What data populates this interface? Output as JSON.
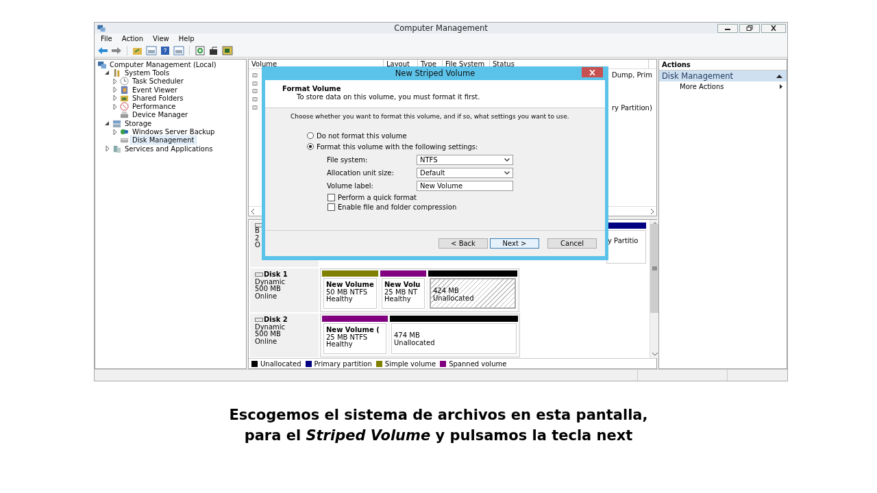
{
  "window": {
    "title": "Computer Management"
  },
  "menu": [
    "File",
    "Action",
    "View",
    "Help"
  ],
  "tree": [
    {
      "label": "Computer Management (Local)",
      "selected": false,
      "children": [
        {
          "label": "System Tools",
          "expanded": true,
          "selected": false,
          "children": [
            {
              "label": "Task Scheduler",
              "expanded": false,
              "selected": false
            },
            {
              "label": "Event Viewer",
              "expanded": false,
              "selected": false
            },
            {
              "label": "Shared Folders",
              "expanded": false,
              "selected": false
            },
            {
              "label": "Performance",
              "expanded": false,
              "selected": false
            },
            {
              "label": "Device Manager",
              "selected": false
            }
          ]
        },
        {
          "label": "Storage",
          "expanded": true,
          "selected": false,
          "children": [
            {
              "label": "Windows Server Backup",
              "expanded": false,
              "selected": false
            },
            {
              "label": "Disk Management",
              "selected": true
            }
          ]
        },
        {
          "label": "Services and Applications",
          "expanded": false,
          "selected": false
        }
      ]
    }
  ],
  "volume_list": {
    "columns": [
      "Volume",
      "Layout",
      "Type",
      "File System",
      "Status"
    ],
    "rows": [
      {
        "status_fragment": "Dump, Prim"
      },
      {},
      {},
      {},
      {
        "status_fragment": "ry Partition)"
      }
    ]
  },
  "disks": [
    {
      "lines": [
        "B",
        "2",
        "O"
      ],
      "partitions": [
        {
          "color": "#000080",
          "lines": [
            "y Partitio"
          ],
          "selected": false
        }
      ]
    },
    {
      "name": "Disk 1",
      "lines": [
        "Dynamic",
        "500 MB",
        "Online"
      ],
      "partitions": [
        {
          "color": "#808000",
          "title": "New Volume",
          "lines": [
            "50 MB NTFS",
            "Healthy"
          ],
          "selected": false
        },
        {
          "color": "#800080",
          "title": "New Volu",
          "lines": [
            "25 MB NT",
            "Healthy"
          ],
          "selected": false
        },
        {
          "color": "#000000",
          "lines": [
            "424 MB",
            "Unallocated"
          ],
          "selected": true
        }
      ]
    },
    {
      "name": "Disk 2",
      "lines": [
        "Dynamic",
        "500 MB",
        "Online"
      ],
      "partitions": [
        {
          "color": "#800080",
          "title": "New Volume  (",
          "lines": [
            "25 MB NTFS",
            "Healthy"
          ],
          "selected": false
        },
        {
          "color": "#000000",
          "lines": [
            "474 MB",
            "Unallocated"
          ],
          "selected": false
        }
      ]
    }
  ],
  "legend": [
    {
      "label": "Unallocated",
      "color": "#000000"
    },
    {
      "label": "Primary partition",
      "color": "#000080"
    },
    {
      "label": "Simple volume",
      "color": "#808000"
    },
    {
      "label": "Spanned volume",
      "color": "#800080"
    }
  ],
  "actions": {
    "title": "Actions",
    "section": "Disk Management",
    "items": [
      "More Actions"
    ]
  },
  "dialog": {
    "title": "New Striped Volume",
    "heading": "Format Volume",
    "subheading": "To store data on this volume, you must format it first.",
    "prompt": "Choose whether you want to format this volume, and if so, what settings you want to use.",
    "options": [
      {
        "label": "Do not format this volume",
        "selected": false
      },
      {
        "label": "Format this volume with the following settings:",
        "selected": true
      }
    ],
    "fields": [
      {
        "kind": "select",
        "label": "File system:",
        "value": "NTFS"
      },
      {
        "kind": "select",
        "label": "Allocation unit size:",
        "value": "Default"
      },
      {
        "kind": "text",
        "label": "Volume label:",
        "value": "New Volume"
      }
    ],
    "checkboxes": [
      {
        "label": "Perform a quick format",
        "checked": false
      },
      {
        "label": "Enable file and folder compression",
        "checked": false
      }
    ],
    "buttons": [
      {
        "label": "< Back",
        "default": false
      },
      {
        "label": "Next >",
        "default": true
      },
      {
        "label": "Cancel",
        "default": false
      }
    ]
  },
  "caption": "Escogemos el sistema de archivos en esta pantalla, para el *Striped Volume* y pulsamos la tecla next"
}
